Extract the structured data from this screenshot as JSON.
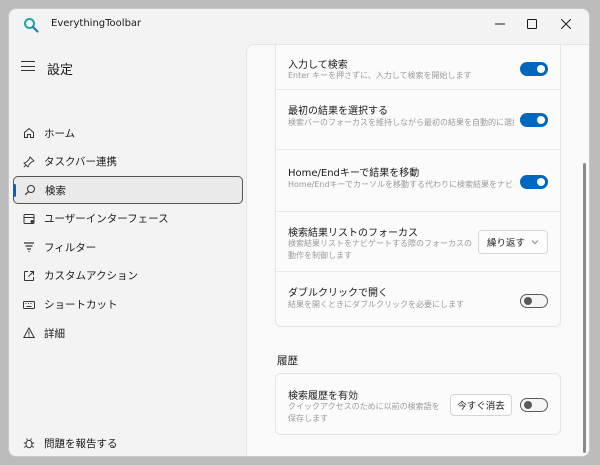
{
  "app": {
    "title": "EverythingToolbar",
    "accent": "#0067c0"
  },
  "sidebar": {
    "title": "設定",
    "items": [
      {
        "label": "ホーム",
        "icon": "home-icon",
        "active": false
      },
      {
        "label": "タスクバー連携",
        "icon": "pin-icon",
        "active": false
      },
      {
        "label": "検索",
        "icon": "search-icon",
        "active": true
      },
      {
        "label": "ユーザーインターフェース",
        "icon": "layout-icon",
        "active": false
      },
      {
        "label": "フィルター",
        "icon": "filter-icon",
        "active": false
      },
      {
        "label": "カスタムアクション",
        "icon": "external-link-icon",
        "active": false
      },
      {
        "label": "ショートカット",
        "icon": "keyboard-icon",
        "active": false
      },
      {
        "label": "詳細",
        "icon": "warning-icon",
        "active": false
      }
    ],
    "footer": {
      "label": "問題を報告する",
      "icon": "bug-icon"
    }
  },
  "settings": {
    "rows": [
      {
        "title": "入力して検索",
        "desc": "Enter キーを押さずに、入力して検索を開始します",
        "toggle": true
      },
      {
        "title": "最初の結果を選択する",
        "desc": "検索バーのフォーカスを維持しながら最初の結果を自動的に選択します",
        "toggle": true
      },
      {
        "title": "Home/Endキーで結果を移動",
        "desc": "Home/Endキーでカーソルを移動する代わりに検索結果をナビゲートします",
        "toggle": true
      },
      {
        "title": "検索結果リストのフォーカス",
        "desc": "検索結果リストをナビゲートする際のフォーカスの動作を制御します",
        "dropdown_value": "繰り返す"
      },
      {
        "title": "ダブルクリックで開く",
        "desc": "結果を開くときにダブルクリックを必要にします",
        "toggle": false
      }
    ],
    "history_section": {
      "title": "履歴",
      "row": {
        "title": "検索履歴を有効",
        "desc": "クイックアクセスのために以前の検索語を保存します",
        "button_label": "今すぐ消去",
        "toggle": false
      }
    }
  }
}
